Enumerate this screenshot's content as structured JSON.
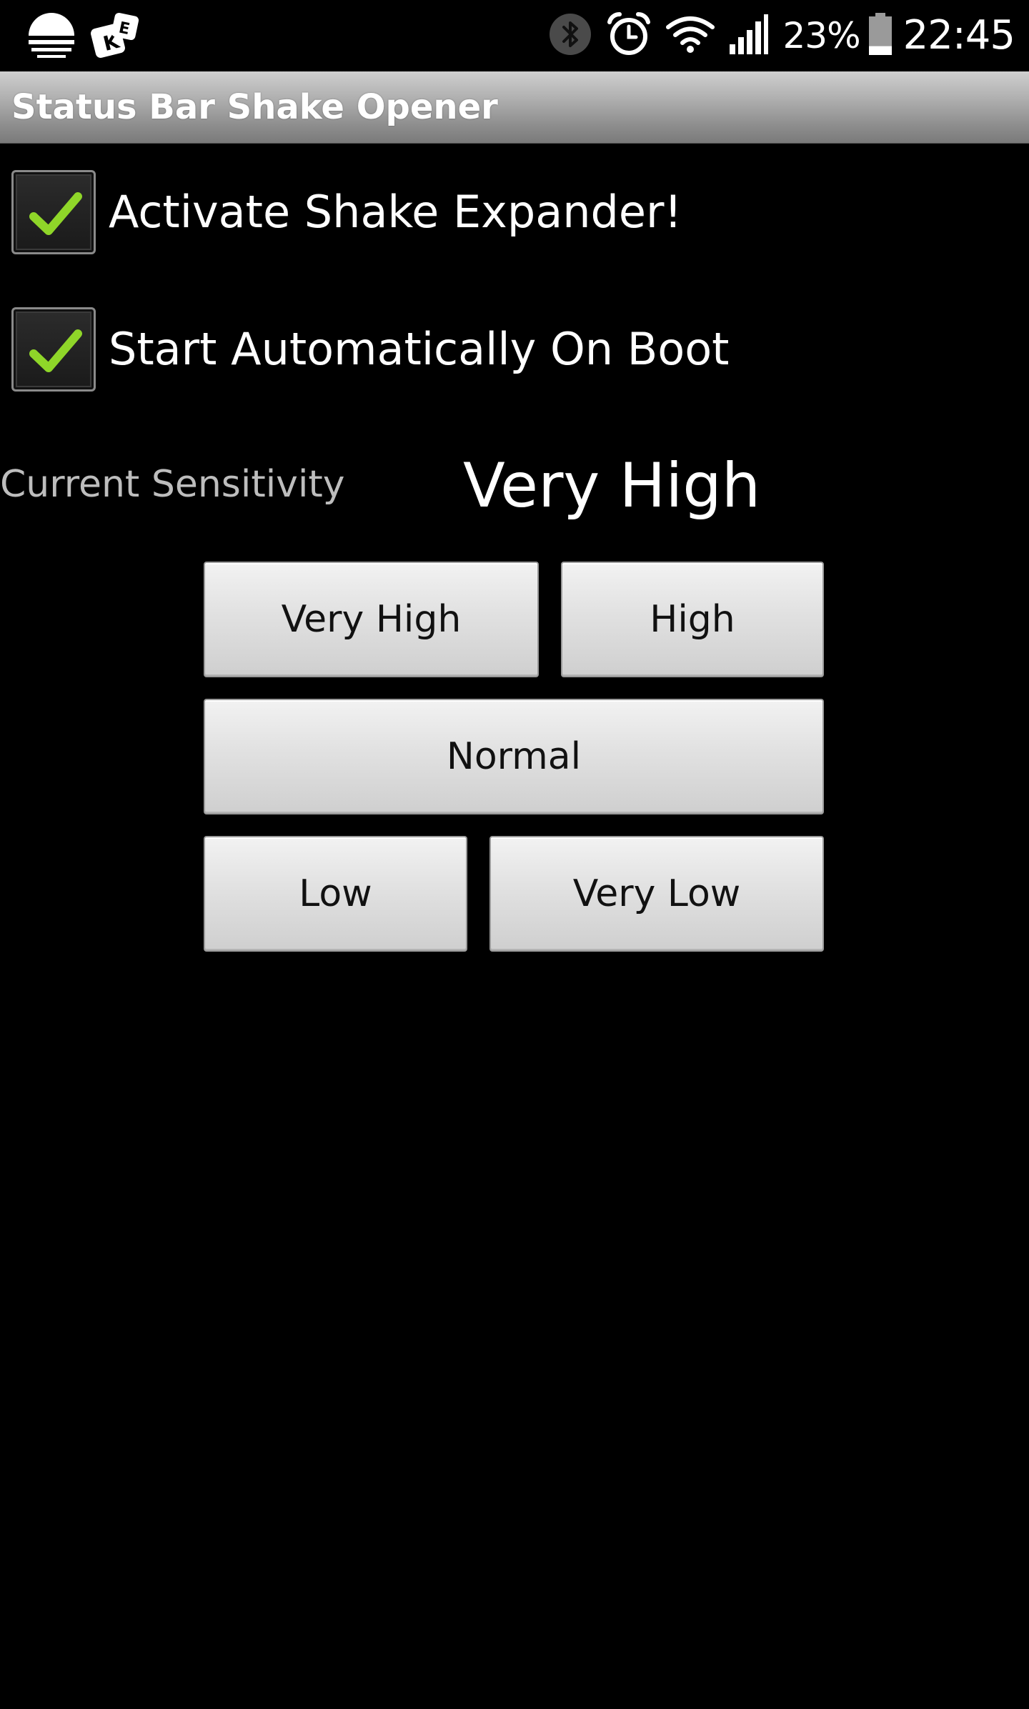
{
  "status_bar": {
    "left_icons": [
      "weather-icon",
      "keyboard-app-icon"
    ],
    "right_icons": [
      "bluetooth-icon",
      "alarm-icon",
      "wifi-icon",
      "cell-signal-icon",
      "battery-icon"
    ],
    "battery_percent": "23%",
    "battery_level": 0.23,
    "clock": "22:45"
  },
  "app": {
    "title": "Status Bar Shake Opener"
  },
  "settings": {
    "activate": {
      "label": "Activate Shake Expander!",
      "checked": true
    },
    "boot": {
      "label": "Start Automatically On Boot",
      "checked": true
    }
  },
  "sensitivity": {
    "label": "Current Sensitivity",
    "value": "Very High"
  },
  "buttons": {
    "very_high": "Very High",
    "high": "High",
    "normal": "Normal",
    "low": "Low",
    "very_low": "Very Low"
  },
  "colors": {
    "check_green": "#8fd629",
    "title_bar": "#9a9a9a",
    "background": "#000000"
  }
}
